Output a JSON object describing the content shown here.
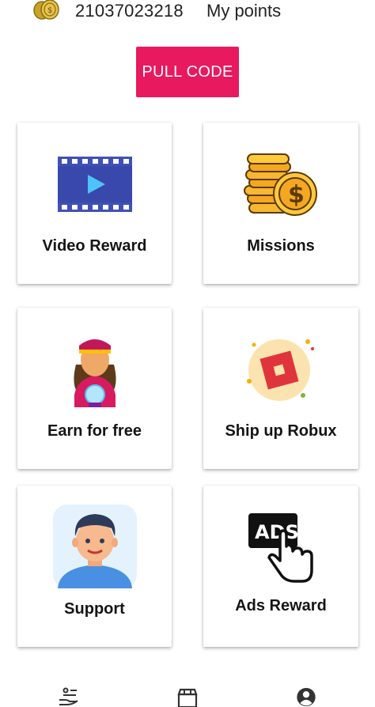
{
  "header": {
    "points_value": "21037023218",
    "points_label": "My points",
    "coin_icon": "coins-icon"
  },
  "pull_code": {
    "label": "PULL CODE"
  },
  "cards": [
    {
      "label": "Video Reward",
      "icon": "video-film-icon"
    },
    {
      "label": "Missions",
      "icon": "coin-stack-icon"
    },
    {
      "label": "Earn for free",
      "icon": "fortune-teller-icon"
    },
    {
      "label": "Ship up Robux",
      "icon": "robux-icon"
    },
    {
      "label": "Support",
      "icon": "support-avatar-icon"
    },
    {
      "label": "Ads Reward",
      "icon": "ads-tap-icon"
    }
  ],
  "bottom_nav": [
    {
      "icon": "earn-hand-icon"
    },
    {
      "icon": "shop-icon"
    },
    {
      "icon": "profile-icon"
    }
  ],
  "colors": {
    "accent": "#e8195f",
    "film_blue": "#3f51b5",
    "coin_gold": "#f5b000",
    "robux_red": "#e0343c"
  }
}
